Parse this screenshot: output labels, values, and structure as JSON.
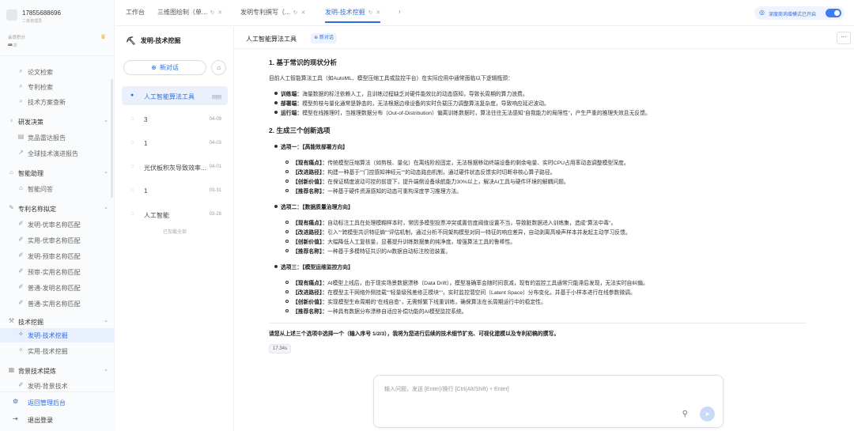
{
  "user": {
    "phone": "17855688696",
    "role": "二级管理员"
  },
  "member": {
    "label": "会员积分",
    "value": "∞",
    "unit": "次"
  },
  "nav": {
    "paper_search": "论文检索",
    "patent_search": "专利检索",
    "tech_search": "技术方案查新",
    "rd_decision": "研发决策",
    "competitor_report": "竞品雷达报告",
    "global_report": "全球技术演进报告",
    "smart_assist": "智能助理",
    "smart_qa": "智能问答",
    "patent_name": "专利名称拟定",
    "p1": "发明-优审名称匹配",
    "p2": "实用-优审名称匹配",
    "p3": "发明-预审名称匹配",
    "p4": "预审-实用名称匹配",
    "p5": "普通-发明名称匹配",
    "p6": "普通-实用名称匹配",
    "tech_mining": "技术挖掘",
    "invention_mining": "发明-技术挖掘",
    "utility_mining": "实用-技术挖掘",
    "bg_extract": "背景技术提炼",
    "bg_partial": "发明-背景技术",
    "back_admin": "返回管理后台",
    "logout": "退出登录"
  },
  "tabs": {
    "t1": "工作台",
    "t2": "三维图绘制（单...",
    "t3": "发明专利撰写（...",
    "t4": "发明-技术挖掘",
    "deep_mode": "深度商询增模式已开启"
  },
  "panel": {
    "title": "发明-技术挖掘",
    "new_chat": "新对话",
    "convs": [
      {
        "title": "人工智能算法工具",
        "time": "刚刚"
      },
      {
        "title": "3",
        "time": "04-09"
      },
      {
        "title": "1",
        "time": "04-03"
      },
      {
        "title": "光伏板积灰导致效率...",
        "time": "04-01"
      },
      {
        "title": "1",
        "time": "03-31"
      },
      {
        "title": "人工智能",
        "time": "03-28"
      }
    ],
    "loaded_all": "已加载全部"
  },
  "main": {
    "title": "人工智能算法工具",
    "new_btn": "新对话",
    "more": "···",
    "h1": "1. 基于常识的现状分析",
    "intro": "目前人工智能算法工具（如AutoML、模型压缩工具或监控平台）在实际应用中通常面临以下逻辑瓶颈：",
    "b1_k": "训练端：",
    "b1_v": "海量数据的标注依赖人工，且训练过程缺乏对硬件能效比的动态感知，导致长周期的算力浪费。",
    "b2_k": "部署端：",
    "b2_v": "模型剪枝与量化通常是静态的，无法根据边缘设备的实时负载压力调整算法复杂度，导致响应延迟波动。",
    "b3_k": "运行端：",
    "b3_v": "模型在线推理时，当推理数据分布（Out-of-Distribution）偏离训练数据时，算法往往无法感知\"自我能力的局限性\"，产生严重的推理失效且无反馈。",
    "h2": "2. 生成三个创新选项",
    "o1": "选项一：【高能效部署方向】",
    "o1_1k": "【现有痛点】：",
    "o1_1v": "传统模型压缩算法（如剪枝、量化）在离线阶段固定，无法根据移动终端设备的剩余电量、实时CPU占用率动态调整模型深度。",
    "o1_2k": "【改进路径】：",
    "o1_2v": "构建一种基于\"\"门控感知神经元\"\"的动态路由机制，通过硬件状态反馈实时切断非核心算子路径。",
    "o1_3k": "【创新价值】：",
    "o1_3v": "在保证精度波动可控的前提下，提升端侧设备续航能力30%以上，解决AI工具与硬件环境的解耦问题。",
    "o1_4k": "【推荐名称】：",
    "o1_4v": "一种基于硬件资源感知的动态可重构深度学习推理方法。",
    "o2": "选项二：【数据质量治理方向】",
    "o2_1k": "【现有痛点】：",
    "o2_1v": "自动标注工具在处理模糊样本时，常因多模型投票冲突或置信度阈值设置不当，导致脏数据进入训练集，造成\"算法中毒\"。",
    "o2_2k": "【改进路径】：",
    "o2_2v": "引入\"\"跨模型共识特征熵\"\"评估机制，通过分析不同架构模型对同一特征的响应差异，自动剥离高噪声样本并发起主动学习反馈。",
    "o2_3k": "【创新价值】：",
    "o2_3v": "大幅降低人工复核量，显著提升训练数据集的纯净度，增强算法工具的鲁棒性。",
    "o2_4k": "【推荐名称】：",
    "o2_4v": "一种基于多模特征共识的AI数据自动标注校验装置。",
    "o3": "选项三：【模型运维监控方向】",
    "o3_1k": "【现有痛点】：",
    "o3_1v": "AI模型上线后，由于现实场景数据漂移（Data Drift），模型准确率会随时间衰减，现有的监控工具通常只能滞后发现，无法实时自纠偏。",
    "o3_2k": "【改进路径】：",
    "o3_2v": "在模型主干网络外侧挂载\"\"轻量级残差修正模块\"\"，实时监控潜空间（Latent Space）分布变化，并基于小样本进行在线参数微调。",
    "o3_3k": "【创新价值】：",
    "o3_3v": "实现模型生命周期的\"在线自愈\"，无需频繁下线重训练，确保算法在长周期运行中的稳定性。",
    "o3_4k": "【推荐名称】：",
    "o3_4v": "一种具有数据分布漂移自适应补偿功能的AI模型监控系统。",
    "ask": "请您从上述三个选项中选择一个（输入序号 1/2/3），我将为您进行后续的技术细节扩充、可视化建模以及专利初稿的撰写。",
    "elapsed": "17.34s",
    "input_placeholder": "输入问题，发送 [Enter]/换行 [Ctrl(Alt/Shift) + Enter]"
  },
  "colors": {
    "accent": "#2f6ee0",
    "active_bg": "#eaf1fd"
  }
}
